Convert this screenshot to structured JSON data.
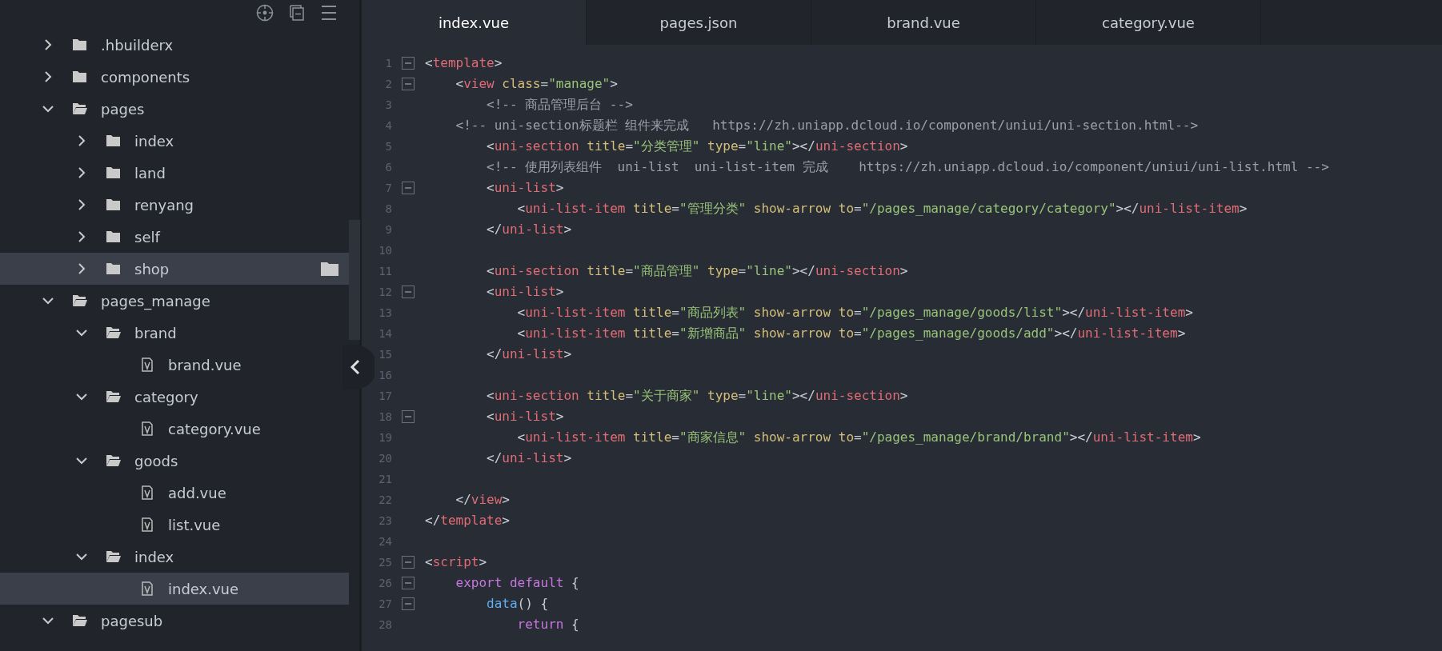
{
  "sidebar": {
    "tree": [
      {
        "name": ".hbuilderx",
        "kind": "folder",
        "expanded": false,
        "selected": false,
        "hovered": false
      },
      {
        "name": "components",
        "kind": "folder",
        "expanded": false,
        "selected": false,
        "hovered": false
      },
      {
        "name": "pages",
        "kind": "folder",
        "expanded": true,
        "selected": false,
        "hovered": false,
        "children": [
          {
            "name": "index",
            "kind": "folder",
            "expanded": false,
            "selected": false,
            "hovered": false
          },
          {
            "name": "land",
            "kind": "folder",
            "expanded": false,
            "selected": false,
            "hovered": false
          },
          {
            "name": "renyang",
            "kind": "folder",
            "expanded": false,
            "selected": false,
            "hovered": false
          },
          {
            "name": "self",
            "kind": "folder",
            "expanded": false,
            "selected": false,
            "hovered": false
          },
          {
            "name": "shop",
            "kind": "folder",
            "expanded": false,
            "selected": true,
            "hovered": true
          }
        ]
      },
      {
        "name": "pages_manage",
        "kind": "folder",
        "expanded": true,
        "selected": false,
        "hovered": false,
        "children": [
          {
            "name": "brand",
            "kind": "folder",
            "expanded": true,
            "selected": false,
            "hovered": false,
            "children": [
              {
                "name": "brand.vue",
                "kind": "file",
                "selected": false,
                "hovered": false
              }
            ]
          },
          {
            "name": "category",
            "kind": "folder",
            "expanded": true,
            "selected": false,
            "hovered": false,
            "children": [
              {
                "name": "category.vue",
                "kind": "file",
                "selected": false,
                "hovered": false
              }
            ]
          },
          {
            "name": "goods",
            "kind": "folder",
            "expanded": true,
            "selected": false,
            "hovered": false,
            "children": [
              {
                "name": "add.vue",
                "kind": "file",
                "selected": false,
                "hovered": false
              },
              {
                "name": "list.vue",
                "kind": "file",
                "selected": false,
                "hovered": false
              }
            ]
          },
          {
            "name": "index",
            "kind": "folder",
            "expanded": true,
            "selected": false,
            "hovered": false,
            "children": [
              {
                "name": "index.vue",
                "kind": "file",
                "selected": true,
                "hovered": false
              }
            ]
          }
        ]
      },
      {
        "name": "pagesub",
        "kind": "folder",
        "expanded": true,
        "selected": false,
        "hovered": false
      }
    ]
  },
  "tabs": [
    {
      "label": "index.vue",
      "selected": true
    },
    {
      "label": "pages.json",
      "selected": false
    },
    {
      "label": "brand.vue",
      "selected": false
    },
    {
      "label": "category.vue",
      "selected": false
    }
  ],
  "editor": {
    "lines": [
      {
        "number": "1",
        "foldable": true,
        "tokens": [
          {
            "kind": "punct",
            "text": "<"
          },
          {
            "kind": "tag",
            "text": "template"
          },
          {
            "kind": "punct",
            "text": ">"
          }
        ]
      },
      {
        "number": "2",
        "foldable": true,
        "tokens": [
          {
            "kind": "punct",
            "text": "    <"
          },
          {
            "kind": "tag",
            "text": "view"
          },
          {
            "kind": "attr",
            "text": " class"
          },
          {
            "kind": "punct",
            "text": "="
          },
          {
            "kind": "string",
            "text": "\"manage\""
          },
          {
            "kind": "punct",
            "text": ">"
          }
        ]
      },
      {
        "number": "3",
        "foldable": false,
        "tokens": [
          {
            "kind": "comment",
            "text": "        <!-- 商品管理后台 -->"
          }
        ]
      },
      {
        "number": "4",
        "foldable": false,
        "tokens": [
          {
            "kind": "comment",
            "text": "    <!-- uni-section标题栏 组件来完成   https://zh.uniapp.dcloud.io/component/uniui/uni-section.html-->"
          }
        ]
      },
      {
        "number": "5",
        "foldable": false,
        "tokens": [
          {
            "kind": "punct",
            "text": "        <"
          },
          {
            "kind": "tag",
            "text": "uni-section"
          },
          {
            "kind": "attr",
            "text": " title"
          },
          {
            "kind": "punct",
            "text": "="
          },
          {
            "kind": "string",
            "text": "\"分类管理\""
          },
          {
            "kind": "attr",
            "text": " type"
          },
          {
            "kind": "punct",
            "text": "="
          },
          {
            "kind": "string",
            "text": "\"line\""
          },
          {
            "kind": "punct",
            "text": "></"
          },
          {
            "kind": "tag",
            "text": "uni-section"
          },
          {
            "kind": "punct",
            "text": ">"
          }
        ]
      },
      {
        "number": "6",
        "foldable": false,
        "tokens": [
          {
            "kind": "comment",
            "text": "        <!-- 使用列表组件  uni-list  uni-list-item 完成    https://zh.uniapp.dcloud.io/component/uniui/uni-list.html -->"
          }
        ]
      },
      {
        "number": "7",
        "foldable": true,
        "tokens": [
          {
            "kind": "punct",
            "text": "        <"
          },
          {
            "kind": "tag",
            "text": "uni-list"
          },
          {
            "kind": "punct",
            "text": ">"
          }
        ]
      },
      {
        "number": "8",
        "foldable": false,
        "tokens": [
          {
            "kind": "punct",
            "text": "            <"
          },
          {
            "kind": "tag",
            "text": "uni-list-item"
          },
          {
            "kind": "attr",
            "text": " title"
          },
          {
            "kind": "punct",
            "text": "="
          },
          {
            "kind": "string",
            "text": "\"管理分类\""
          },
          {
            "kind": "attr",
            "text": " show-arrow to"
          },
          {
            "kind": "punct",
            "text": "="
          },
          {
            "kind": "string",
            "text": "\"/pages_manage/category/category\""
          },
          {
            "kind": "punct",
            "text": "></"
          },
          {
            "kind": "tag",
            "text": "uni-list-item"
          },
          {
            "kind": "punct",
            "text": ">"
          }
        ]
      },
      {
        "number": "9",
        "foldable": false,
        "tokens": [
          {
            "kind": "punct",
            "text": "        </"
          },
          {
            "kind": "tag",
            "text": "uni-list"
          },
          {
            "kind": "punct",
            "text": ">"
          }
        ]
      },
      {
        "number": "10",
        "foldable": false
      },
      {
        "number": "11",
        "foldable": false,
        "tokens": [
          {
            "kind": "punct",
            "text": "        <"
          },
          {
            "kind": "tag",
            "text": "uni-section"
          },
          {
            "kind": "attr",
            "text": " title"
          },
          {
            "kind": "punct",
            "text": "="
          },
          {
            "kind": "string",
            "text": "\"商品管理\""
          },
          {
            "kind": "attr",
            "text": " type"
          },
          {
            "kind": "punct",
            "text": "="
          },
          {
            "kind": "string",
            "text": "\"line\""
          },
          {
            "kind": "punct",
            "text": "></"
          },
          {
            "kind": "tag",
            "text": "uni-section"
          },
          {
            "kind": "punct",
            "text": ">"
          }
        ]
      },
      {
        "number": "12",
        "foldable": true,
        "tokens": [
          {
            "kind": "punct",
            "text": "        <"
          },
          {
            "kind": "tag",
            "text": "uni-list"
          },
          {
            "kind": "punct",
            "text": ">"
          }
        ]
      },
      {
        "number": "13",
        "foldable": false,
        "tokens": [
          {
            "kind": "punct",
            "text": "            <"
          },
          {
            "kind": "tag",
            "text": "uni-list-item"
          },
          {
            "kind": "attr",
            "text": " title"
          },
          {
            "kind": "punct",
            "text": "="
          },
          {
            "kind": "string",
            "text": "\"商品列表\""
          },
          {
            "kind": "attr",
            "text": " show-arrow to"
          },
          {
            "kind": "punct",
            "text": "="
          },
          {
            "kind": "string",
            "text": "\"/pages_manage/goods/list\""
          },
          {
            "kind": "punct",
            "text": "></"
          },
          {
            "kind": "tag",
            "text": "uni-list-item"
          },
          {
            "kind": "punct",
            "text": ">"
          }
        ]
      },
      {
        "number": "14",
        "foldable": false,
        "tokens": [
          {
            "kind": "punct",
            "text": "            <"
          },
          {
            "kind": "tag",
            "text": "uni-list-item"
          },
          {
            "kind": "attr",
            "text": " title"
          },
          {
            "kind": "punct",
            "text": "="
          },
          {
            "kind": "string",
            "text": "\"新增商品\""
          },
          {
            "kind": "attr",
            "text": " show-arrow to"
          },
          {
            "kind": "punct",
            "text": "="
          },
          {
            "kind": "string",
            "text": "\"/pages_manage/goods/add\""
          },
          {
            "kind": "punct",
            "text": "></"
          },
          {
            "kind": "tag",
            "text": "uni-list-item"
          },
          {
            "kind": "punct",
            "text": ">"
          }
        ]
      },
      {
        "number": "15",
        "foldable": false,
        "tokens": [
          {
            "kind": "punct",
            "text": "        </"
          },
          {
            "kind": "tag",
            "text": "uni-list"
          },
          {
            "kind": "punct",
            "text": ">"
          }
        ]
      },
      {
        "number": "16",
        "foldable": false
      },
      {
        "number": "17",
        "foldable": false,
        "tokens": [
          {
            "kind": "punct",
            "text": "        <"
          },
          {
            "kind": "tag",
            "text": "uni-section"
          },
          {
            "kind": "attr",
            "text": " title"
          },
          {
            "kind": "punct",
            "text": "="
          },
          {
            "kind": "string",
            "text": "\"关于商家\""
          },
          {
            "kind": "attr",
            "text": " type"
          },
          {
            "kind": "punct",
            "text": "="
          },
          {
            "kind": "string",
            "text": "\"line\""
          },
          {
            "kind": "punct",
            "text": "></"
          },
          {
            "kind": "tag",
            "text": "uni-section"
          },
          {
            "kind": "punct",
            "text": ">"
          }
        ]
      },
      {
        "number": "18",
        "foldable": true,
        "tokens": [
          {
            "kind": "punct",
            "text": "        <"
          },
          {
            "kind": "tag",
            "text": "uni-list"
          },
          {
            "kind": "punct",
            "text": ">"
          }
        ]
      },
      {
        "number": "19",
        "foldable": false,
        "tokens": [
          {
            "kind": "punct",
            "text": "            <"
          },
          {
            "kind": "tag",
            "text": "uni-list-item"
          },
          {
            "kind": "attr",
            "text": " title"
          },
          {
            "kind": "punct",
            "text": "="
          },
          {
            "kind": "string",
            "text": "\"商家信息\""
          },
          {
            "kind": "attr",
            "text": " show-arrow to"
          },
          {
            "kind": "punct",
            "text": "="
          },
          {
            "kind": "string",
            "text": "\"/pages_manage/brand/brand\""
          },
          {
            "kind": "punct",
            "text": "></"
          },
          {
            "kind": "tag",
            "text": "uni-list-item"
          },
          {
            "kind": "punct",
            "text": ">"
          }
        ]
      },
      {
        "number": "20",
        "foldable": false,
        "tokens": [
          {
            "kind": "punct",
            "text": "        </"
          },
          {
            "kind": "tag",
            "text": "uni-list"
          },
          {
            "kind": "punct",
            "text": ">"
          }
        ]
      },
      {
        "number": "21",
        "foldable": false
      },
      {
        "number": "22",
        "foldable": false,
        "tokens": [
          {
            "kind": "punct",
            "text": "    </"
          },
          {
            "kind": "tag",
            "text": "view"
          },
          {
            "kind": "punct",
            "text": ">"
          }
        ]
      },
      {
        "number": "23",
        "foldable": false,
        "tokens": [
          {
            "kind": "punct",
            "text": "</"
          },
          {
            "kind": "tag",
            "text": "template"
          },
          {
            "kind": "punct",
            "text": ">"
          }
        ]
      },
      {
        "number": "24",
        "foldable": false
      },
      {
        "number": "25",
        "foldable": true,
        "tokens": [
          {
            "kind": "punct",
            "text": "<"
          },
          {
            "kind": "tag",
            "text": "script"
          },
          {
            "kind": "punct",
            "text": ">"
          }
        ]
      },
      {
        "number": "26",
        "foldable": true,
        "tokens": [
          {
            "kind": "keyword",
            "text": "    export default"
          },
          {
            "kind": "punct",
            "text": " {"
          }
        ]
      },
      {
        "number": "27",
        "foldable": true,
        "tokens": [
          {
            "kind": "func",
            "text": "        data"
          },
          {
            "kind": "punct",
            "text": "() {"
          }
        ]
      },
      {
        "number": "28",
        "foldable": false,
        "tokens": [
          {
            "kind": "keyword",
            "text": "            return"
          },
          {
            "kind": "punct",
            "text": " {"
          }
        ]
      }
    ]
  }
}
